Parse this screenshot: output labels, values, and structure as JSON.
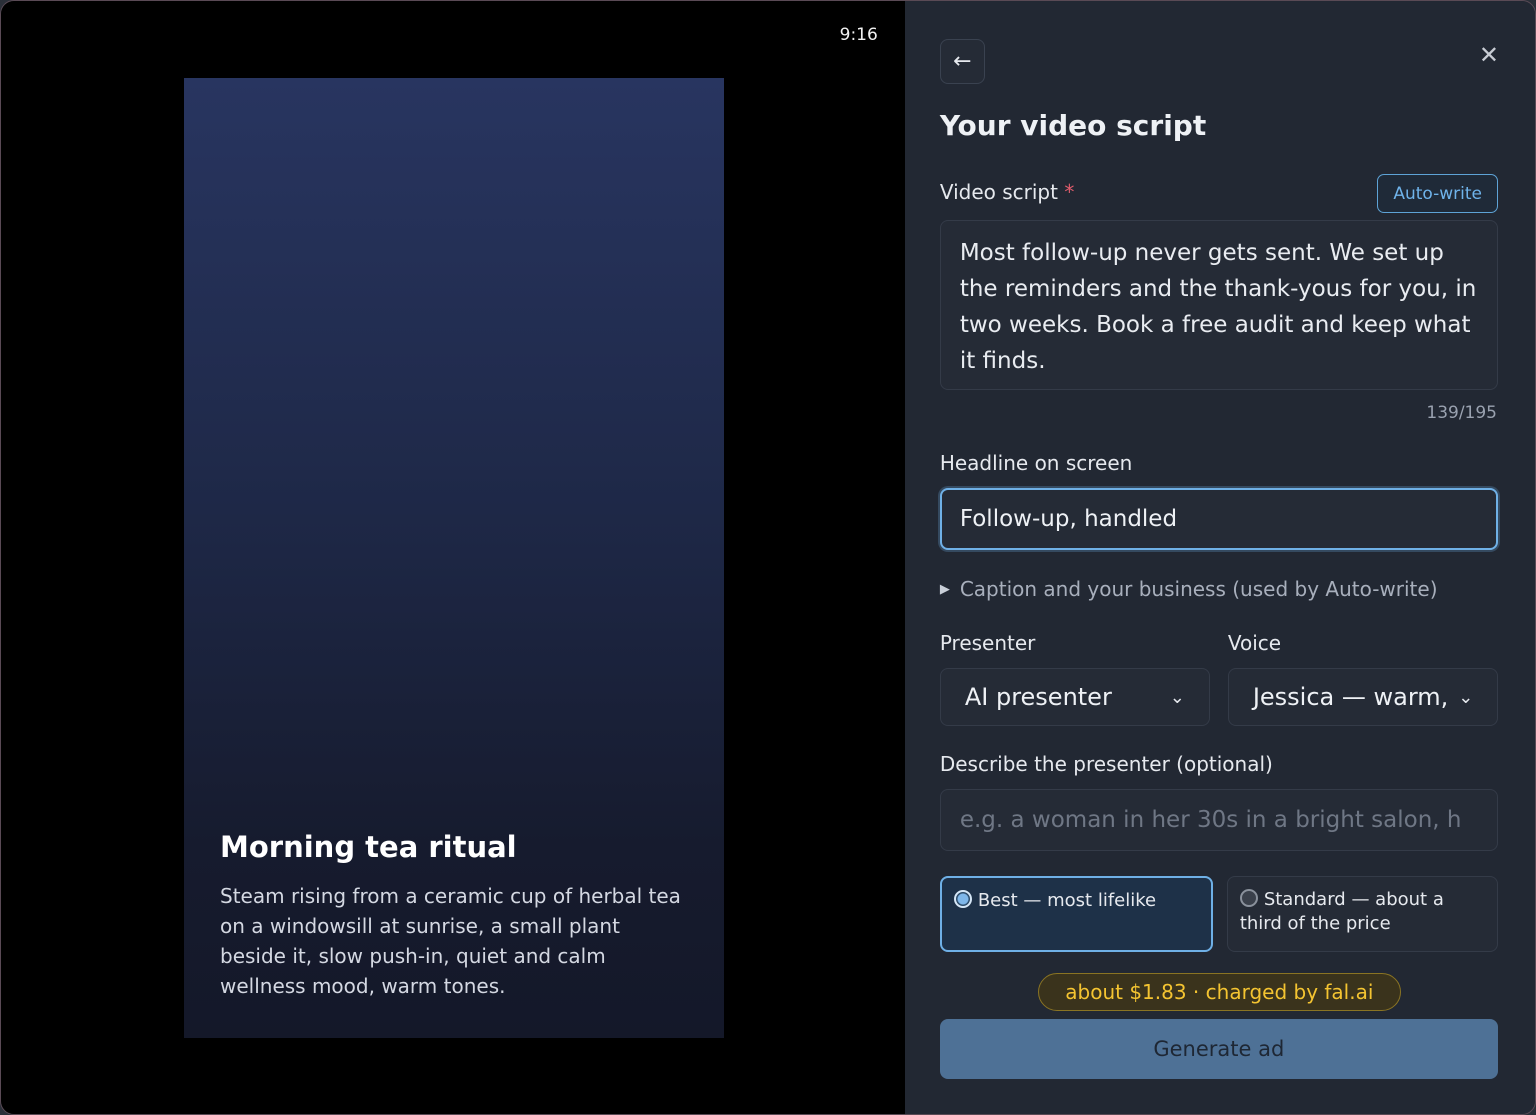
{
  "preview": {
    "aspect_ratio": "9:16",
    "card": {
      "title": "Morning tea ritual",
      "description": "Steam rising from a ceramic cup of herbal tea on a windowsill at sunrise, a small plant beside it, slow push-in, quiet and calm wellness mood, warm tones."
    }
  },
  "panel": {
    "back_icon": "arrow-left-icon",
    "back_glyph": "←",
    "close_icon": "close-icon",
    "close_glyph": "✕",
    "title": "Your video script",
    "script": {
      "label": "Video script",
      "required_mark": "*",
      "auto_write_label": "Auto-write",
      "value": "Most follow-up never gets sent. We set up the reminders and the thank-yous for you, in two weeks. Book a free audit and keep what it finds.",
      "counter": "139/195"
    },
    "headline": {
      "label": "Headline on screen",
      "value": "Follow-up, handled"
    },
    "details_label": "Caption and your business (used by Auto-write)",
    "presenter": {
      "label": "Presenter",
      "selected": "AI presenter"
    },
    "voice": {
      "label": "Voice",
      "selected": "Jessica — warm,"
    },
    "describe": {
      "label": "Describe the presenter (optional)",
      "placeholder": "e.g. a woman in her 30s in a bright salon, h"
    },
    "quality_options": [
      {
        "label": "Best — most lifelike",
        "selected": true
      },
      {
        "label": "Standard — about a third of the price",
        "selected": false
      }
    ],
    "price_badge": "about $1.83 · charged by fal.ai",
    "generate_label": "Generate ad"
  },
  "colors": {
    "accent": "#6fb0e6",
    "price": "#f4c431",
    "generate_bg": "#4e7196",
    "required": "#e05c6c"
  }
}
